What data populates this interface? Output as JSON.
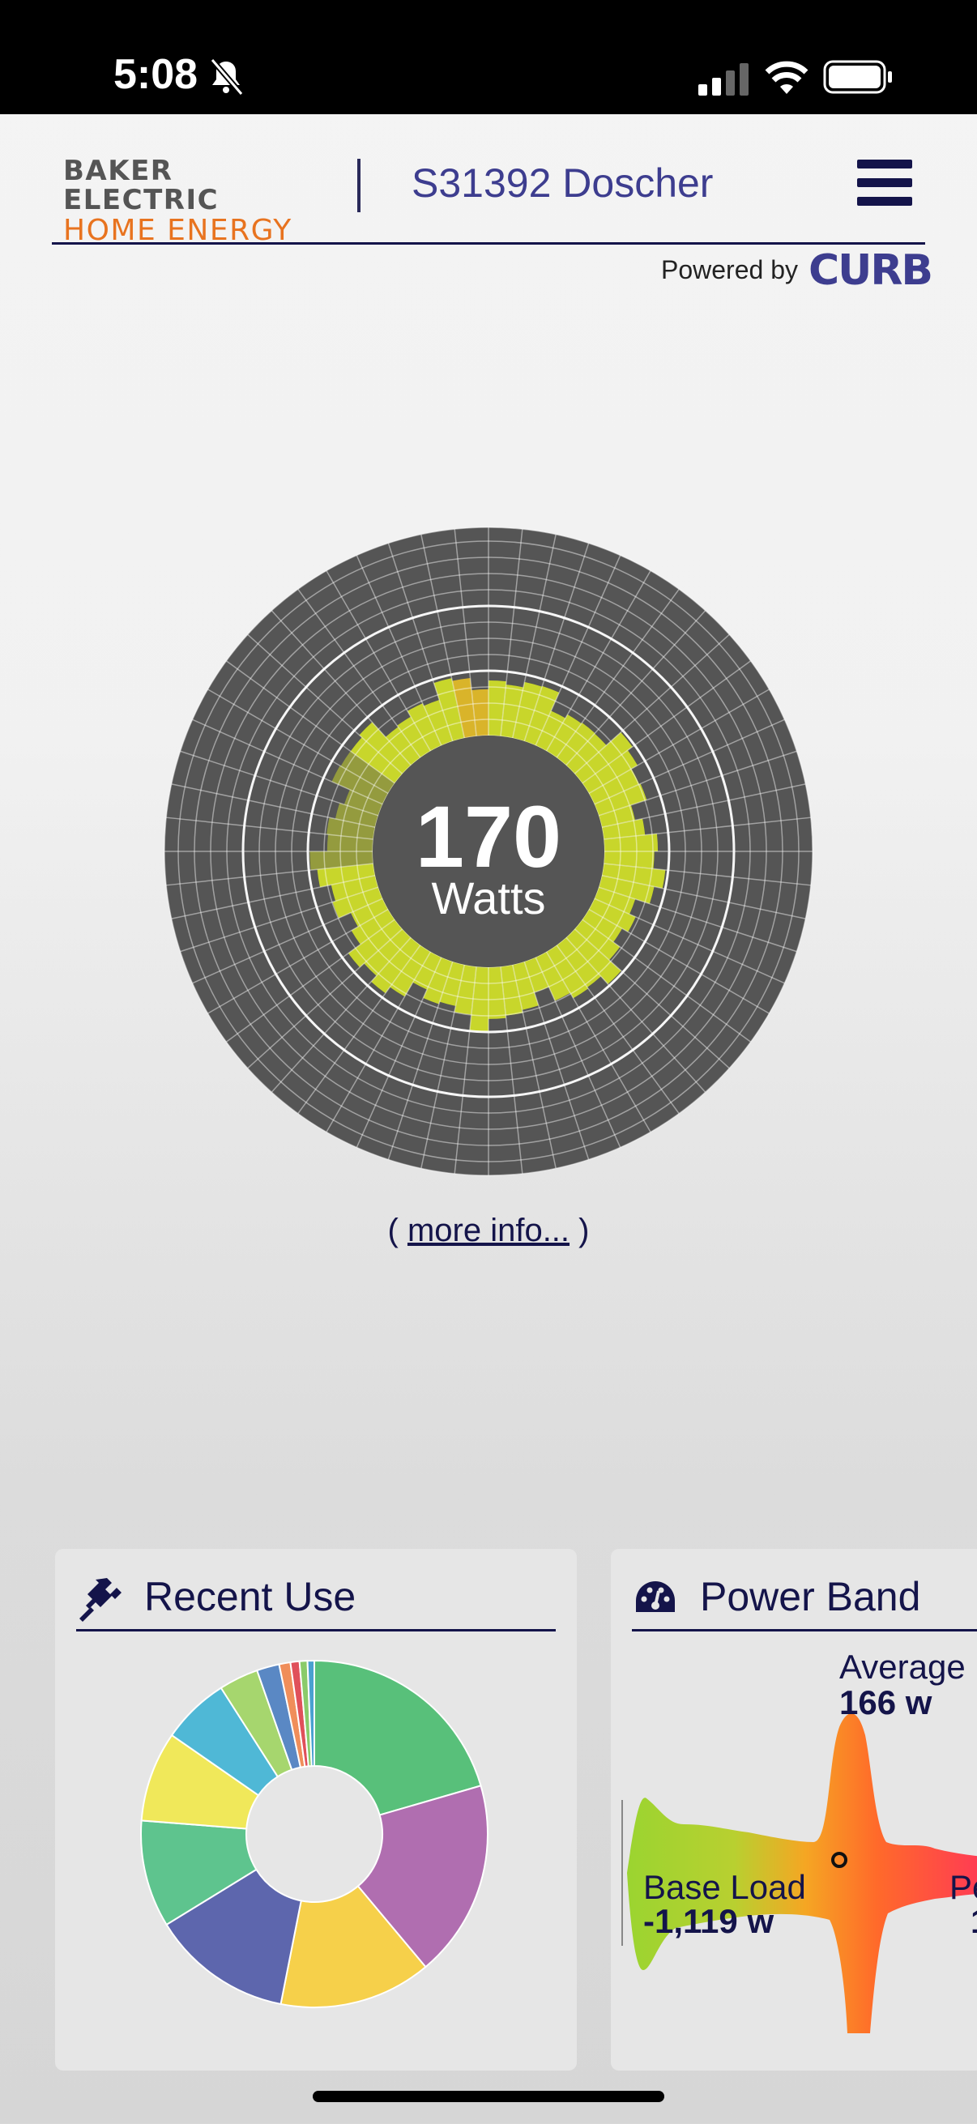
{
  "status_bar": {
    "time": "5:08",
    "icons": [
      "bell-slash-icon",
      "cellular-signal-icon",
      "wifi-icon",
      "battery-icon"
    ]
  },
  "header": {
    "brand_top": "BAKER ELECTRIC",
    "brand_bottom": "HOME ENERGY",
    "site_title": "S31392 Doscher",
    "powered_by": "Powered by",
    "curb_logo": "CURB",
    "menu_icon": "hamburger-menu-icon"
  },
  "live_power": {
    "value": "170",
    "unit": "Watts",
    "more_info_open": "( ",
    "more_info_link": "more info...",
    "more_info_close": " )",
    "colors": {
      "ring_background": "#555555",
      "usage_fill": "#c8d62b",
      "highlight": "#d9b42a"
    }
  },
  "recent_use": {
    "title": "Recent Use",
    "icon": "plug-icon",
    "chart_data": {
      "type": "pie",
      "title": "",
      "values": [
        19.5,
        17.5,
        13.5,
        12.5,
        9.5,
        8,
        6,
        3.5,
        2,
        1,
        0.8,
        0.7,
        0.6
      ],
      "colors": [
        "#58c07a",
        "#b06eb0",
        "#f6d04a",
        "#5d66ad",
        "#5ec48e",
        "#f0e85a",
        "#4fb8d6",
        "#a6d66e",
        "#5a88c4",
        "#f08e5a",
        "#e0505a",
        "#8acb6a",
        "#4aa0d0"
      ]
    }
  },
  "power_band": {
    "title": "Power Band",
    "icon": "gauge-icon",
    "average_label": "Average",
    "average_value": "166 w",
    "base_label": "Base Load",
    "base_value": "-1,119 w",
    "peak_label_partial": "Pe",
    "peak_value_partial": "1",
    "colors": [
      "#9bd430",
      "#f5a623",
      "#ff6a2a",
      "#ff3a55"
    ]
  }
}
